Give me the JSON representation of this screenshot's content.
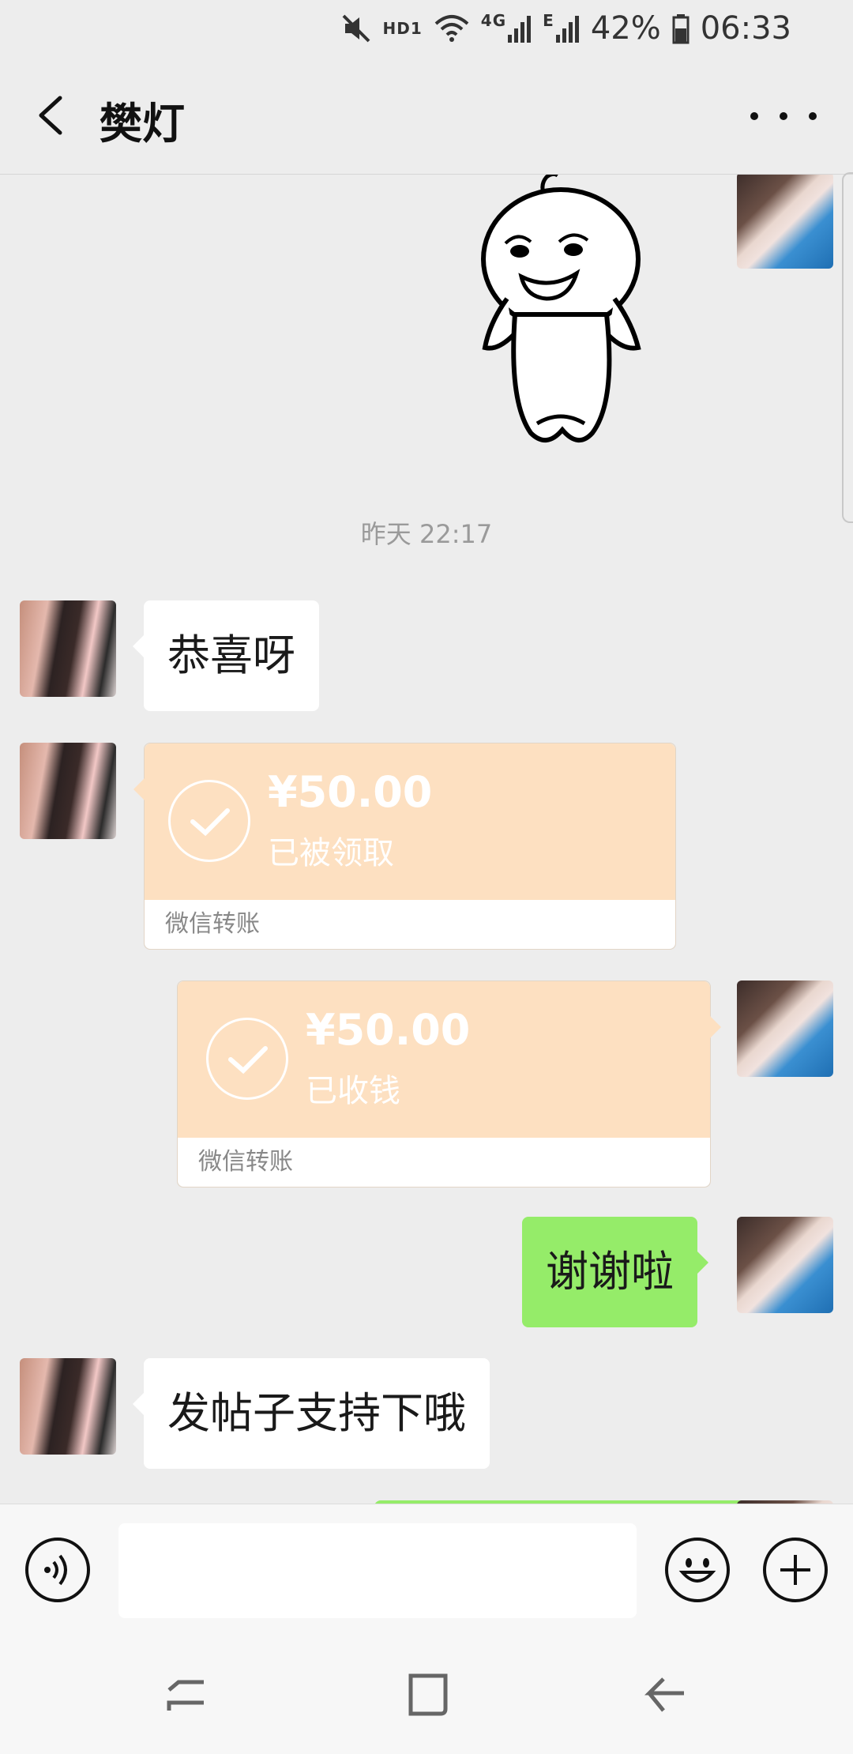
{
  "status_bar": {
    "network": "HD1",
    "network_type": "4G",
    "edge": "E",
    "battery": "42%",
    "time": "06:33"
  },
  "header": {
    "title": "樊灯"
  },
  "chat": {
    "timestamp": "昨天 22:17",
    "messages": [
      {
        "text": "恭喜呀"
      },
      {
        "amount": "¥50.00",
        "status": "已被领取",
        "label": "微信转账"
      },
      {
        "amount": "¥50.00",
        "status": "已收钱",
        "label": "微信转账"
      },
      {
        "text": "谢谢啦"
      },
      {
        "text": "发帖子支持下哦"
      }
    ]
  },
  "icons": {
    "mute": "mute-icon",
    "wifi": "wifi-icon",
    "signal": "signal-icon",
    "battery": "battery-icon",
    "back": "back-arrow-icon",
    "more": "more-icon",
    "voice": "voice-icon",
    "emoji": "emoji-icon",
    "plus": "plus-icon",
    "recents": "recents-icon",
    "home": "home-icon",
    "nav_back": "nav-back-icon"
  },
  "colors": {
    "background": "#ededed",
    "my_bubble": "#95ec69",
    "their_bubble": "#ffffff",
    "transfer_card": "#fde0c1"
  }
}
